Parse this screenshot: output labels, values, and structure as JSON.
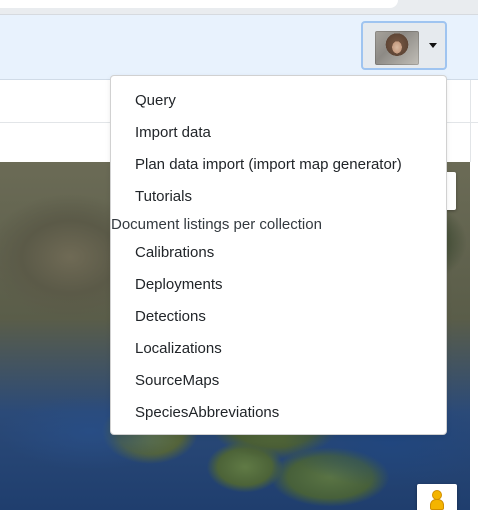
{
  "header": {
    "user_menu": {
      "avatar_icon": "user-avatar",
      "caret_icon": "caret-down-icon"
    }
  },
  "dropdown": {
    "items_top": [
      {
        "label": "Query"
      },
      {
        "label": "Import data"
      },
      {
        "label": "Plan data import (import map generator)"
      },
      {
        "label": "Tutorials"
      }
    ],
    "section_header": "Document listings per collection",
    "collections": [
      {
        "label": "Calibrations"
      },
      {
        "label": "Deployments"
      },
      {
        "label": "Detections"
      },
      {
        "label": "Localizations"
      },
      {
        "label": "SourceMaps"
      },
      {
        "label": "SpeciesAbbreviations"
      }
    ]
  },
  "map": {
    "pegman_icon": "street-view-pegman-icon"
  }
}
